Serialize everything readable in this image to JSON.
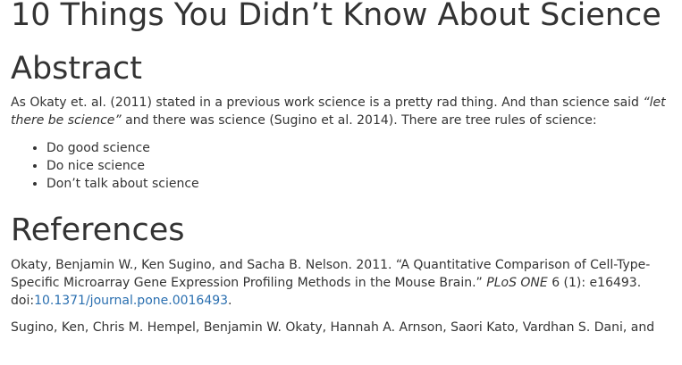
{
  "title": "10 Things You Didn’t Know About Science",
  "abstract": {
    "heading": "Abstract",
    "text_before": "As Okaty et. al. (2011) stated in a previous work science is a pretty rad thing. And than science said ",
    "quote": "“let there be science”",
    "text_after": " and there was science (Sugino et al. 2014). There are tree rules of science:",
    "rules": [
      "Do good science",
      "Do nice science",
      "Don’t talk about science"
    ]
  },
  "references": {
    "heading": "References",
    "items": [
      {
        "text_before": "Okaty, Benjamin W., Ken Sugino, and Sacha B. Nelson. 2011. “A Quantitative Comparison of Cell-Type-Specific Microarray Gene Expression Profiling Methods in the Mouse Brain.” ",
        "journal": "PLoS ONE",
        "text_after": " 6 (1): e16493. doi:",
        "doi": "10.1371/journal.pone.0016493",
        "end": "."
      },
      {
        "text_before": "Sugino, Ken, Chris M. Hempel, Benjamin W. Okaty, Hannah A. Arnson, Saori Kato, Vardhan S. Dani, and"
      }
    ]
  }
}
